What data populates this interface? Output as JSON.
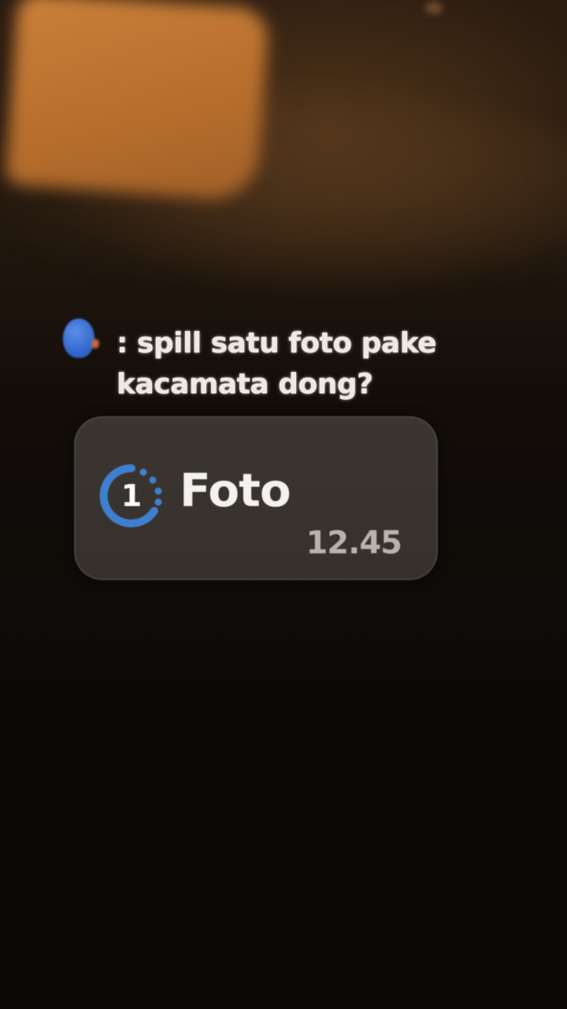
{
  "comment": {
    "avatar_icon": "blue-head-emoji-icon",
    "text": ": spill satu foto pake kacamata dong?"
  },
  "notification": {
    "icon": "view-once-1-icon",
    "icon_digit": "1",
    "title": "Foto",
    "time": "12.45",
    "accent_color": "#3f7fd0"
  }
}
